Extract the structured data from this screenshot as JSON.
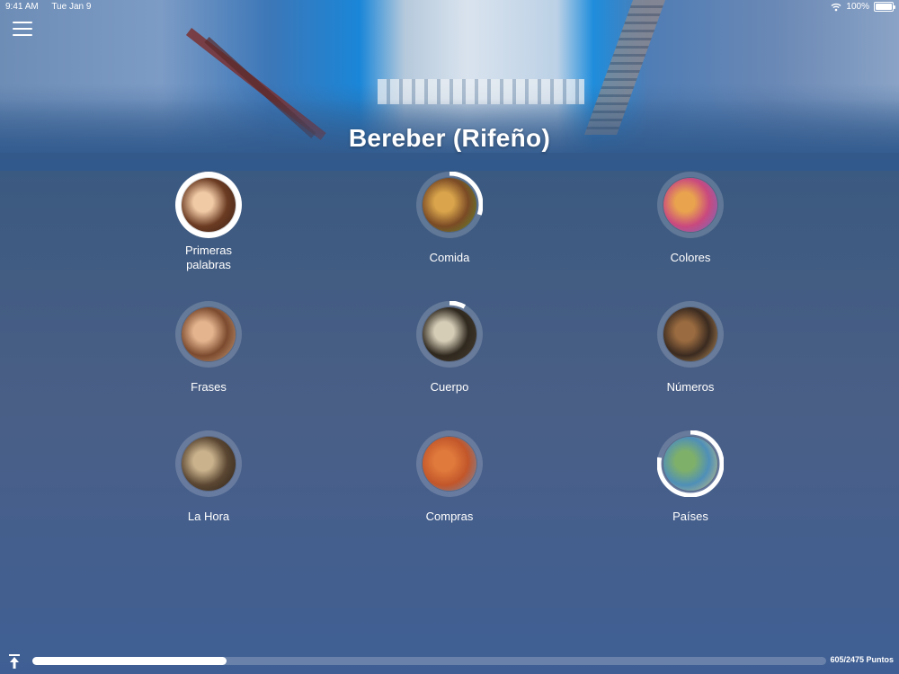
{
  "status_bar": {
    "time": "9:41 AM",
    "date": "Tue Jan 9",
    "battery": "100%"
  },
  "header": {
    "title": "Bereber (Rifeño)"
  },
  "topics": [
    {
      "label": "Primeras palabras",
      "progress": 0.95,
      "image": "child-photo",
      "colors": [
        "#6b3b22",
        "#f0c9a5",
        "#3d2318"
      ]
    },
    {
      "label": "Comida",
      "progress": 0.3,
      "image": "burger-photo",
      "colors": [
        "#7a4a25",
        "#d9a44b",
        "#5f8e2d"
      ]
    },
    {
      "label": "Colores",
      "progress": 0.0,
      "image": "color-powder-photo",
      "colors": [
        "#c9497e",
        "#e9a34e",
        "#6a6ec9"
      ]
    },
    {
      "label": "Frases",
      "progress": 0.0,
      "image": "woman-photo",
      "colors": [
        "#7c4a2e",
        "#e3b48e",
        "#caa07c"
      ]
    },
    {
      "label": "Cuerpo",
      "progress": 0.08,
      "image": "skeleton-photo",
      "colors": [
        "#2f281e",
        "#d6cdb7",
        "#4a4032"
      ]
    },
    {
      "label": "Números",
      "progress": 0.0,
      "image": "numbers-photo",
      "colors": [
        "#3a2a20",
        "#9a6b40",
        "#c79a60"
      ]
    },
    {
      "label": "La Hora",
      "progress": 0.0,
      "image": "alarm-clock-photo",
      "colors": [
        "#5a4632",
        "#c9b28c",
        "#2c2218"
      ]
    },
    {
      "label": "Compras",
      "progress": 0.0,
      "image": "shopping-cart-photo",
      "colors": [
        "#c2562a",
        "#e07a3c",
        "#6b8fb7"
      ]
    },
    {
      "label": "Países",
      "progress": 0.78,
      "image": "map-photo",
      "colors": [
        "#4f8fb8",
        "#7fb06a",
        "#d6c67a"
      ]
    }
  ],
  "footer": {
    "points_text": "605/2475 Puntos",
    "points": 605,
    "points_total": 2475
  }
}
